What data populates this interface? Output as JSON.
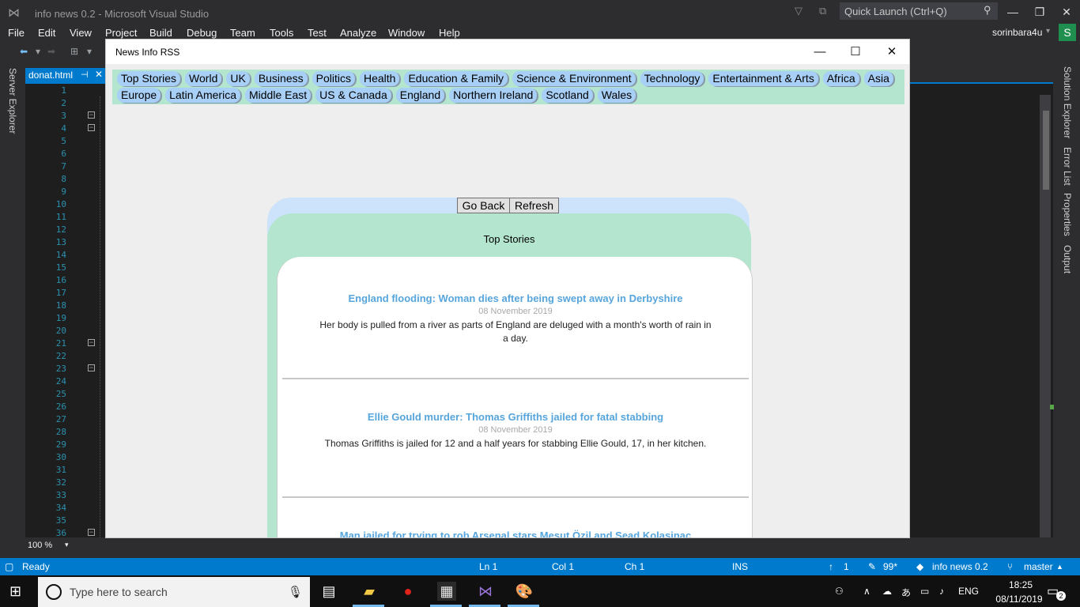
{
  "vs": {
    "title": "info  news 0.2 - Microsoft Visual Studio",
    "quick_launch_placeholder": "Quick Launch (Ctrl+Q)",
    "account": "sorinbara4u",
    "avatar_letter": "S",
    "menu": [
      "File",
      "Edit",
      "View",
      "Project",
      "Build",
      "Debug",
      "Team",
      "Tools",
      "Test",
      "Analyze",
      "Window",
      "Help"
    ],
    "doc_tab": "donat.html",
    "left_tab": "Server Explorer",
    "right_tabs": [
      "Solution Explorer",
      "Error List",
      "Properties",
      "Output"
    ],
    "zoom": "100 %",
    "line_numbers": [
      "1",
      "2",
      "3",
      "4",
      "5",
      "6",
      "7",
      "8",
      "9",
      "10",
      "11",
      "12",
      "13",
      "14",
      "15",
      "16",
      "17",
      "18",
      "19",
      "20",
      "21",
      "22",
      "23",
      "24",
      "25",
      "26",
      "27",
      "28",
      "29",
      "30",
      "31",
      "32",
      "33",
      "34",
      "35",
      "36"
    ],
    "status": {
      "ready": "Ready",
      "ln": "Ln 1",
      "col": "Col 1",
      "ch": "Ch 1",
      "ins": "INS",
      "up_count": "1",
      "edits": "99*",
      "repo": "info  news 0.2",
      "branch": "master"
    }
  },
  "news": {
    "window_title": "News Info RSS",
    "categories": [
      "Top Stories",
      "World",
      "UK",
      "Business",
      "Politics",
      "Health",
      "Education & Family",
      "Science & Environment",
      "Technology",
      "Entertainment & Arts",
      "Africa",
      "Asia",
      "Europe",
      "Latin America",
      "Middle East",
      "US & Canada",
      "England",
      "Northern Ireland",
      "Scotland",
      "Wales"
    ],
    "go_back": "Go Back",
    "refresh": "Refresh",
    "section_title": "Top Stories",
    "articles": [
      {
        "title": "England flooding: Woman dies after being swept away in Derbyshire",
        "date": "08 November 2019",
        "desc": "Her body is pulled from a river as parts of England are deluged with a month's worth of rain in a day."
      },
      {
        "title": "Ellie Gould murder: Thomas Griffiths jailed for fatal stabbing",
        "date": "08 November 2019",
        "desc": "Thomas Griffiths is jailed for 12 and a half years for stabbing Ellie Gould, 17, in her kitchen."
      },
      {
        "title": "Man jailed for trying to rob Arsenal stars Mesut Özil and Sead Kolasinac",
        "date": "",
        "desc": ""
      }
    ]
  },
  "taskbar": {
    "search_placeholder": "Type here to search",
    "language": "ENG",
    "time": "18:25",
    "date": "08/11/2019",
    "notifications": "2"
  }
}
